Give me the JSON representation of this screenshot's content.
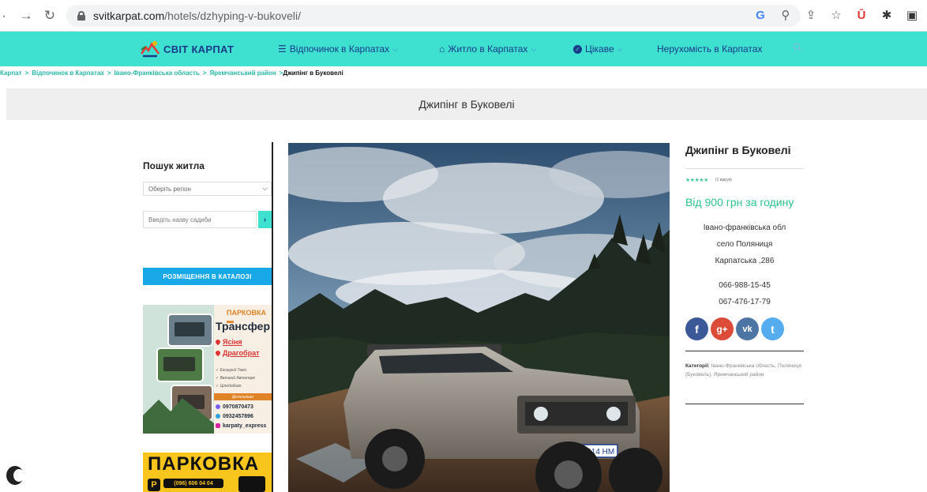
{
  "browser": {
    "url_host": "svitkarpat.com",
    "url_path": "/hotels/dzhyping-v-bukoveli/"
  },
  "nav": {
    "logo_text": "СВІТ КАРПАТ",
    "menu": [
      {
        "label": "Відпочинок в Карпатах",
        "icon": "list-icon",
        "has_dropdown": true
      },
      {
        "label": "Житло в Карпатах",
        "icon": "home-icon",
        "has_dropdown": true
      },
      {
        "label": "Цікаве",
        "icon": "check-circle-icon",
        "has_dropdown": true
      },
      {
        "label": "Нерухомість в Карпатах",
        "icon": "",
        "has_dropdown": false
      }
    ],
    "colors": {
      "bar": "#3ee0cf",
      "text": "#1a3a8a"
    }
  },
  "breadcrumb": {
    "items": [
      "Карпат",
      "Відпочинок в Карпатах",
      "Івано-Франківська область",
      "Яремчанський район"
    ],
    "current": "Джипінг в Буковелі"
  },
  "page": {
    "title": "Джипінг в Буковелі"
  },
  "sidebar": {
    "search_title": "Пошук житла",
    "region_select": "Оберіть регіон",
    "name_placeholder": "Введіть назву садиби",
    "go_label": "›",
    "catalog_button": "РОЗМІЩЕННЯ В КАТАЛОЗІ",
    "banner1": {
      "parking": "ПАРКОВКА",
      "title": "Трансфер",
      "locations": [
        "Ясіня",
        "Драгобрат"
      ],
      "services": [
        "Екскурсії Таксі",
        "Великий Автопарк",
        "Цілодобово"
      ],
      "more": "Детальніше",
      "phones": [
        "0970870473",
        "0932457896"
      ],
      "instagram": "karpaty_express"
    },
    "banner2": {
      "title": "ПАРКОВКА",
      "p_letter": "P",
      "phone": "(096) 606 04 04"
    }
  },
  "info": {
    "title": "Джипінг в Буковелі",
    "stars": "★★★★★",
    "reviews": "(1 відгук)",
    "price": "Від 900 грн за годину",
    "address": [
      "Івано-франківська обл",
      "село Поляниця",
      "Карпатська ,286"
    ],
    "phones": [
      "066-988-15-45",
      "067-476-17-79"
    ],
    "socials": [
      {
        "name": "facebook",
        "glyph": "f",
        "color": "#3b5998"
      },
      {
        "name": "google-plus",
        "glyph": "g+",
        "color": "#dd4b39"
      },
      {
        "name": "vk",
        "glyph": "vk",
        "color": "#4c75a3"
      },
      {
        "name": "twitter",
        "glyph": "t",
        "color": "#55acee"
      }
    ],
    "categories_label": "Категорії:",
    "categories": "Івано-Франківська область, Поляниця (Буковель), Яремчанський район"
  },
  "photo": {
    "plate": "AT 5114 HM"
  }
}
